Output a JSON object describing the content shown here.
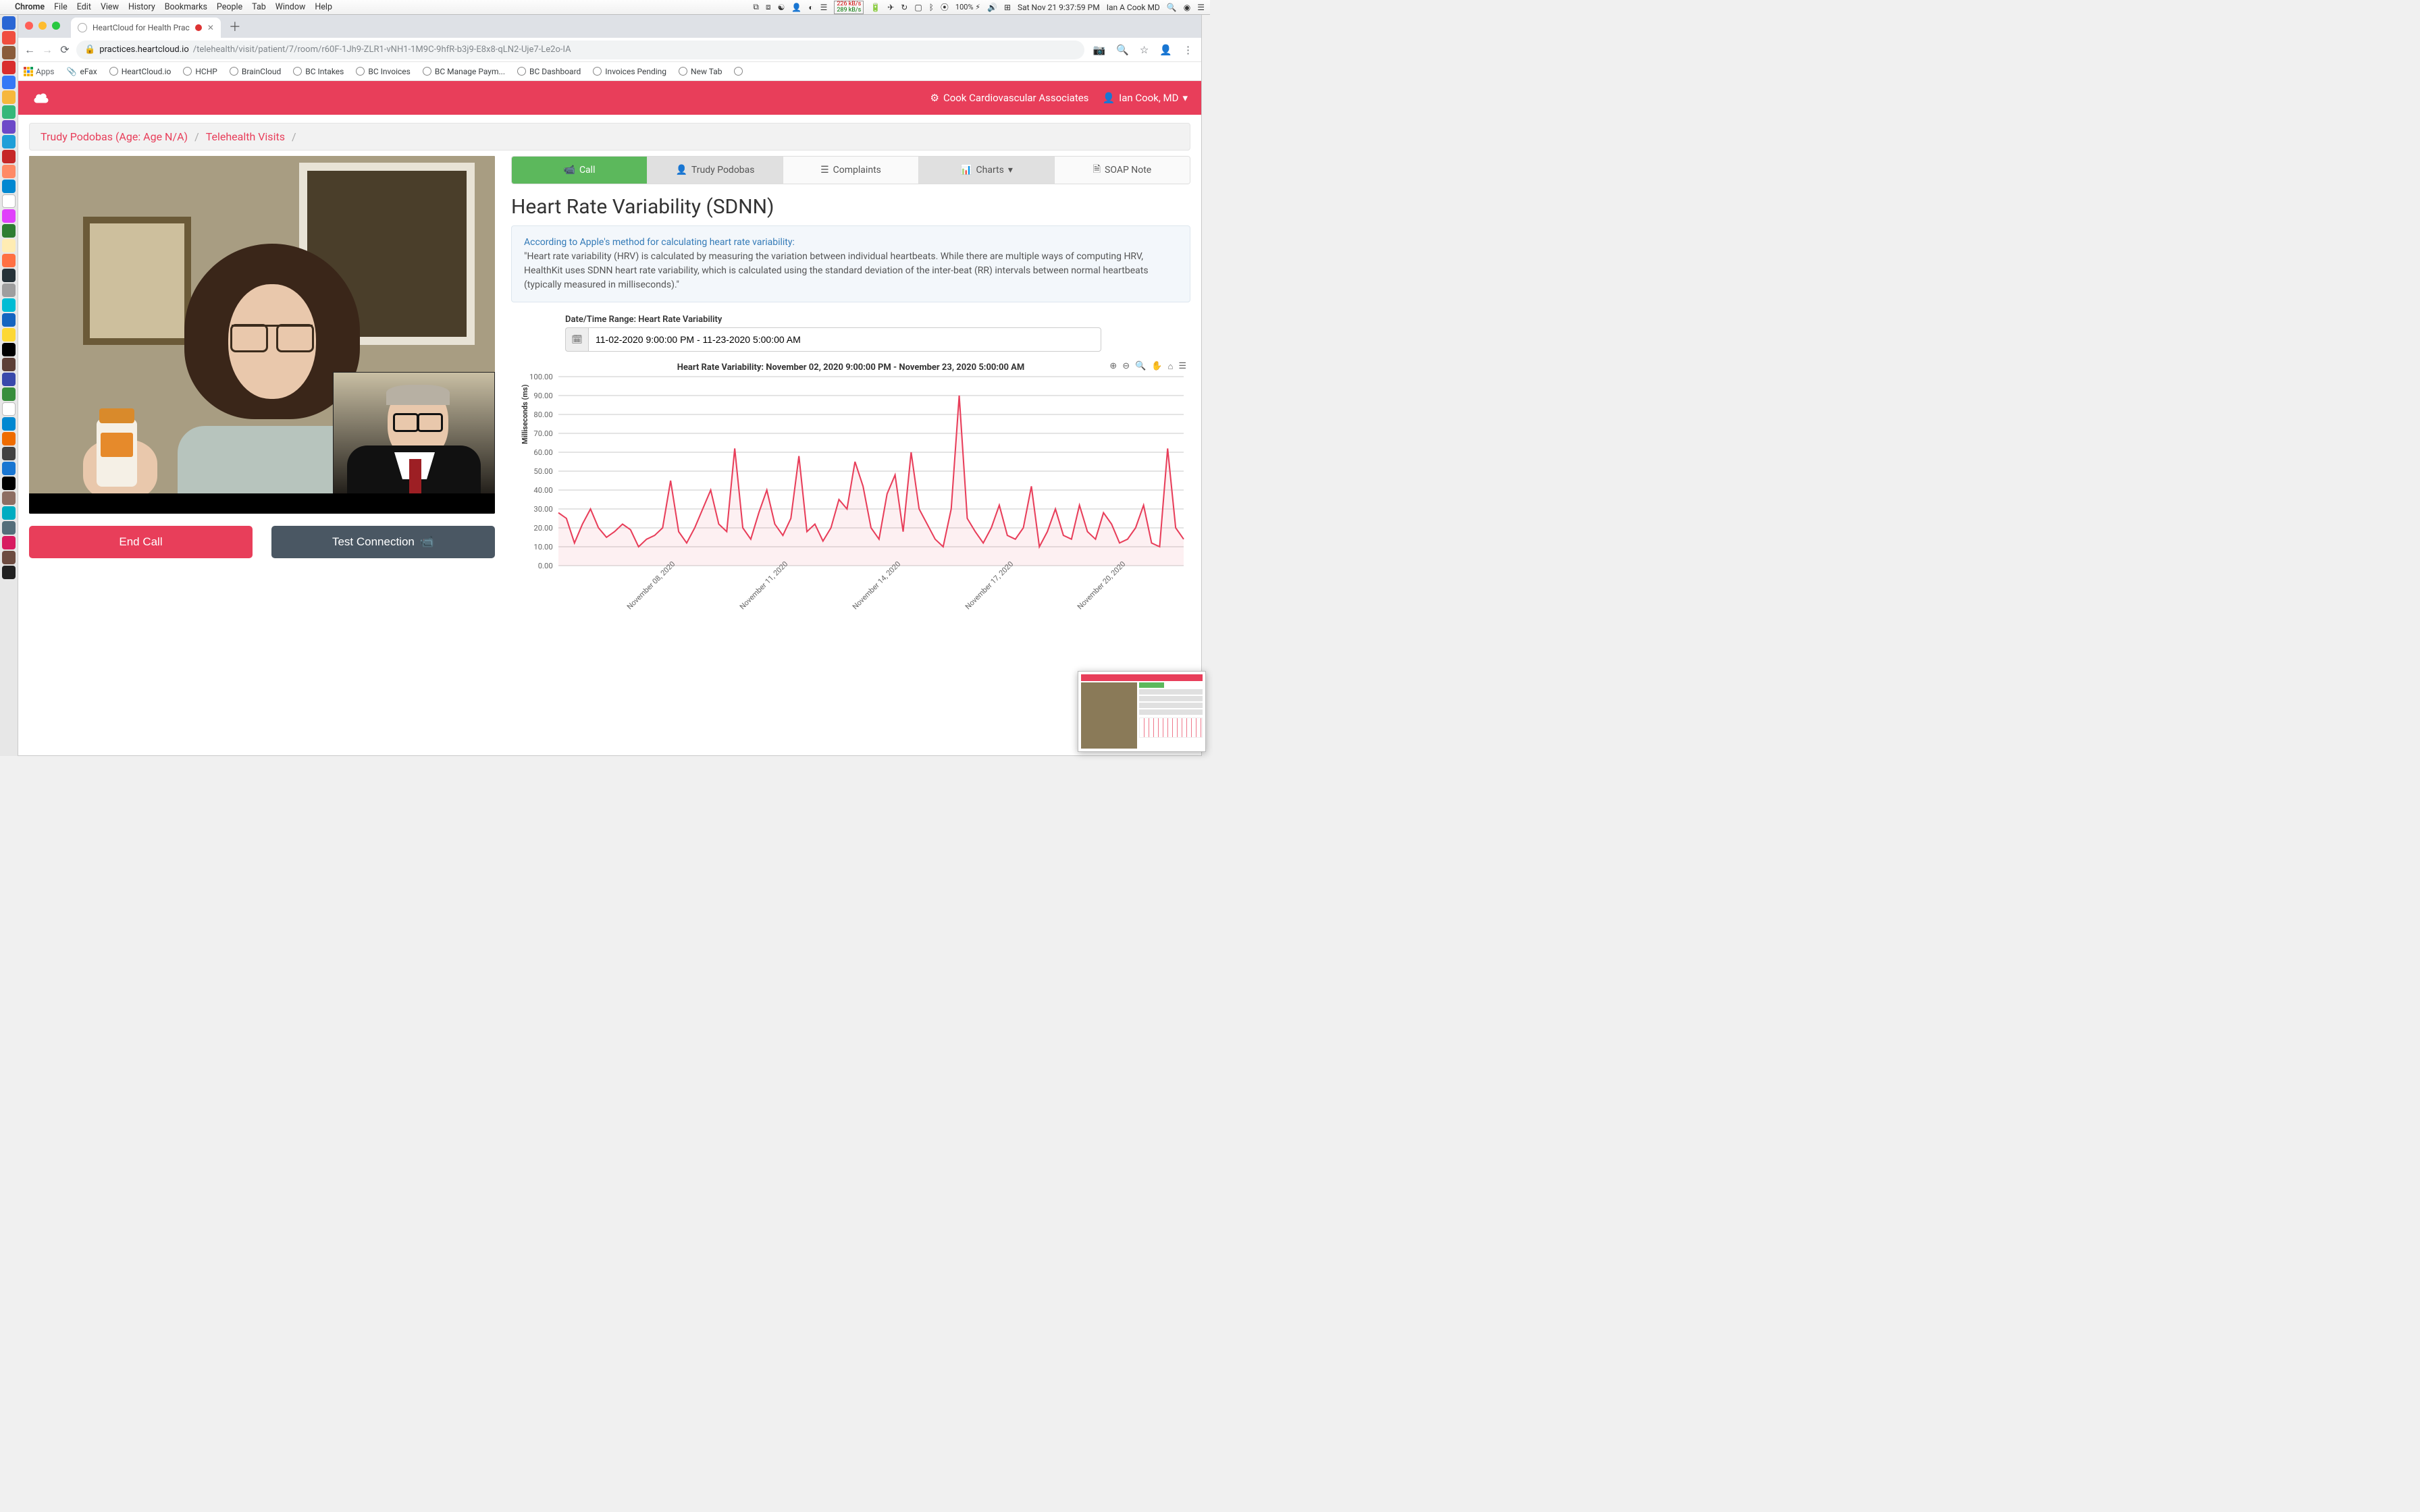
{
  "mac_menu": {
    "app": "Chrome",
    "items": [
      "File",
      "Edit",
      "View",
      "History",
      "Bookmarks",
      "People",
      "Tab",
      "Window",
      "Help"
    ],
    "net_up": "226 kB/s",
    "net_down": "289 kB/s",
    "battery": "100%",
    "battery_badge": "⚡︎",
    "clock": "Sat Nov 21  9:37:59 PM",
    "user": "Ian A Cook MD"
  },
  "chrome": {
    "tab_title": "HeartCloud for Health Prac",
    "url_host": "practices.heartcloud.io",
    "url_path": "/telehealth/visit/patient/7/room/r60F-1Jh9-ZLR1-vNH1-1M9C-9hfR-b3j9-E8x8-qLN2-Uje7-Le2o-IA",
    "bookmarks": [
      "Apps",
      "eFax",
      "HeartCloud.io",
      "HCHP",
      "BrainCloud",
      "BC Intakes",
      "BC Invoices",
      "BC Manage Paym...",
      "BC Dashboard",
      "Invoices Pending",
      "New Tab"
    ]
  },
  "header": {
    "org": "Cook Cardiovascular Associates",
    "user": "Ian Cook, MD"
  },
  "breadcrumb": {
    "patient": "Trudy Podobas (Age: Age N/A)",
    "section": "Telehealth Visits"
  },
  "video": {
    "end_call": "End Call",
    "test_conn": "Test Connection"
  },
  "tabs": {
    "call": "Call",
    "patient": "Trudy Podobas",
    "complaints": "Complaints",
    "charts": "Charts",
    "soap": "SOAP Note"
  },
  "section_title": "Heart Rate Variability (SDNN)",
  "apple_note": {
    "link": "According to Apple's method for calculating heart rate variability:",
    "body": "\"Heart rate variability (HRV) is calculated by measuring the variation between individual heartbeats. While there are multiple ways of computing HRV, HealthKit uses SDNN heart rate variability, which is calculated using the standard deviation of the inter-beat (RR) intervals between normal heartbeats (typically measured in milliseconds).\""
  },
  "range": {
    "label": "Date/Time Range: Heart Rate Variability",
    "value": "11-02-2020 9:00:00 PM - 11-23-2020 5:00:00 AM"
  },
  "chart_data": {
    "type": "line",
    "title": "Heart Rate Variability: November 02, 2020 9:00:00 PM - November 23, 2020 5:00:00 AM",
    "ylabel": "Milliseconds (ms)",
    "ylim": [
      0,
      100
    ],
    "yticks": [
      0,
      10,
      20,
      30,
      40,
      50,
      60,
      70,
      80,
      90,
      100
    ],
    "x_tick_labels": [
      "November 08, 2020",
      "November 11, 2020",
      "November 14, 2020",
      "November 17, 2020",
      "November 20, 2020"
    ],
    "x_tick_pos": [
      0.18,
      0.36,
      0.54,
      0.72,
      0.9
    ],
    "series": [
      {
        "name": "SDNN",
        "values": [
          28,
          25,
          12,
          22,
          30,
          20,
          15,
          18,
          22,
          19,
          10,
          14,
          16,
          20,
          45,
          18,
          12,
          20,
          30,
          40,
          22,
          18,
          62,
          20,
          14,
          28,
          40,
          22,
          16,
          25,
          58,
          18,
          22,
          13,
          20,
          35,
          30,
          55,
          42,
          20,
          14,
          38,
          48,
          18,
          60,
          30,
          22,
          14,
          10,
          30,
          90,
          25,
          18,
          12,
          20,
          32,
          16,
          14,
          20,
          42,
          10,
          18,
          30,
          16,
          14,
          32,
          18,
          14,
          28,
          22,
          12,
          14,
          20,
          32,
          12,
          10,
          62,
          20,
          14
        ]
      }
    ]
  }
}
